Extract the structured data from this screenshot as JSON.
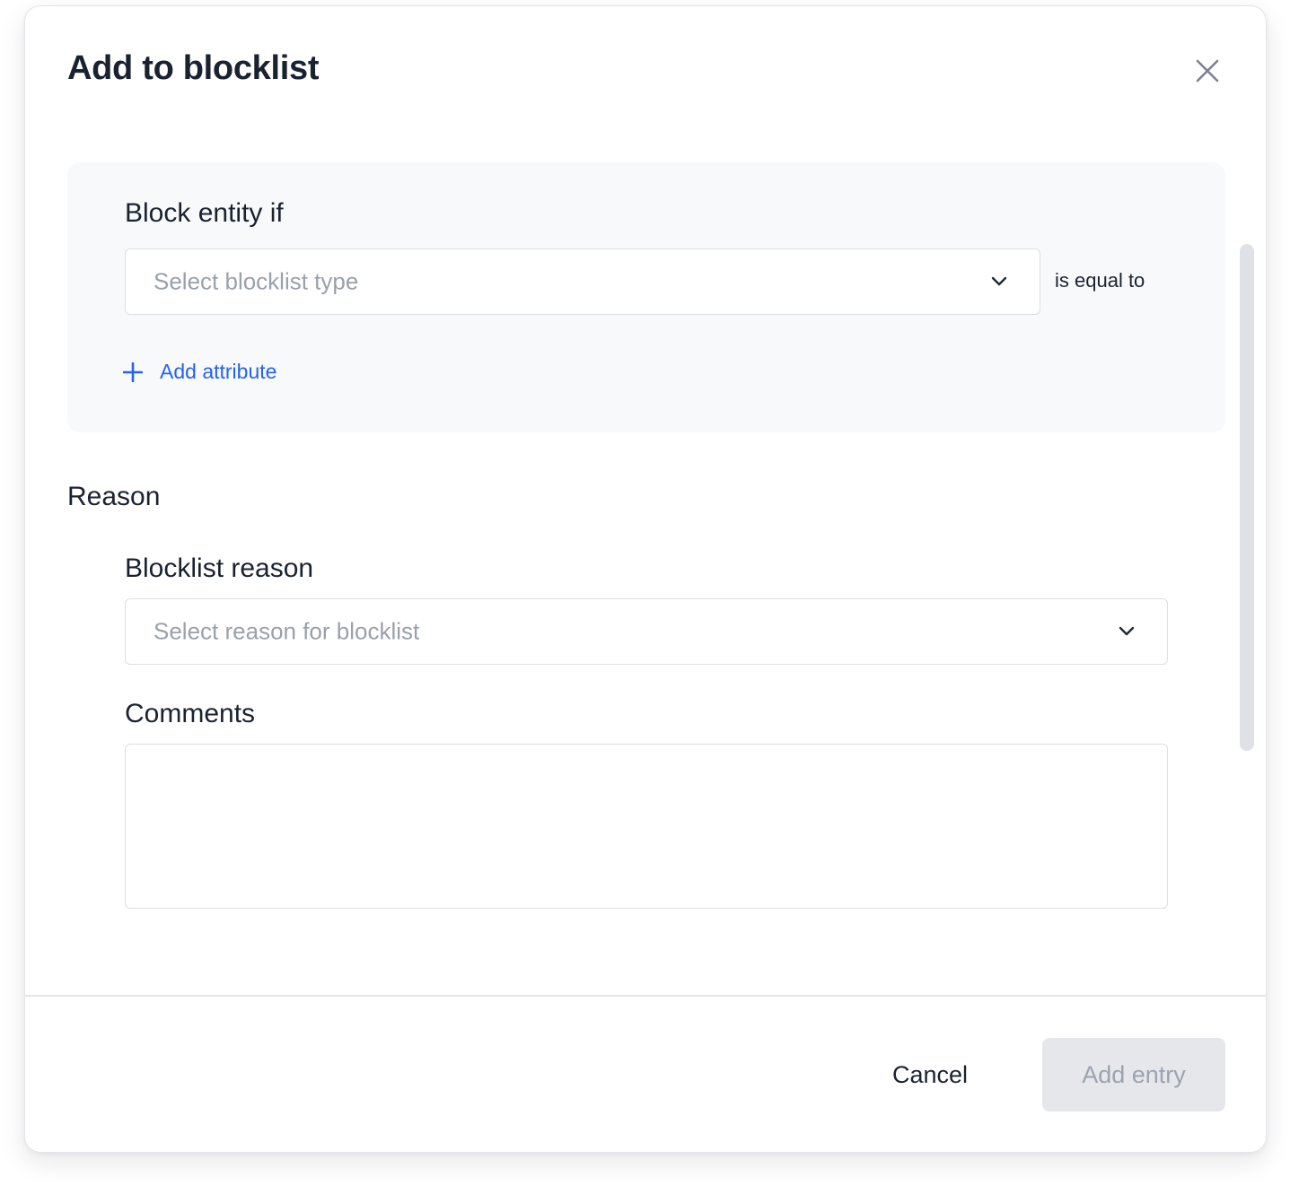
{
  "dialog": {
    "title": "Add to blocklist",
    "close_icon": "close-icon"
  },
  "condition": {
    "heading": "Block entity if",
    "type_select": {
      "placeholder": "Select blocklist type",
      "icon": "chevron-down-icon"
    },
    "operator_text": "is equal to",
    "add_attribute": {
      "label": "Add attribute",
      "icon": "plus-icon"
    }
  },
  "reason": {
    "heading": "Reason",
    "blocklist_reason": {
      "label": "Blocklist reason",
      "placeholder": "Select reason for blocklist",
      "icon": "chevron-down-icon"
    },
    "comments": {
      "label": "Comments",
      "value": ""
    }
  },
  "footer": {
    "cancel_label": "Cancel",
    "submit_label": "Add entry",
    "submit_disabled": true
  },
  "colors": {
    "accent": "#2563eb",
    "panel_bg": "#f8f9fb",
    "disabled_bg": "#e5e7eb",
    "disabled_text": "#9ca3ad",
    "placeholder_text": "#9aa1ab",
    "heading_text": "#1a2231"
  }
}
